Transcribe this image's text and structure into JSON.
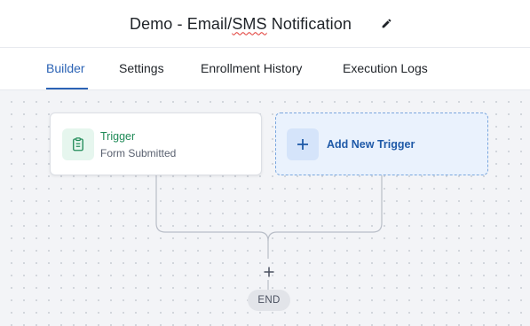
{
  "header": {
    "title_before": "Demo - Email/",
    "title_flagged": "SMS",
    "title_after": " Notification",
    "edit_icon": "pencil-icon"
  },
  "tabs": [
    {
      "label": "Builder",
      "active": true
    },
    {
      "label": "Settings",
      "active": false
    },
    {
      "label": "Enrollment History",
      "active": false
    },
    {
      "label": "Execution Logs",
      "active": false
    }
  ],
  "workflow": {
    "trigger": {
      "title": "Trigger",
      "subtitle": "Form Submitted",
      "icon": "clipboard-icon"
    },
    "add_trigger": {
      "label": "Add New Trigger",
      "icon": "plus-icon"
    },
    "add_step_icon": "plus-icon",
    "end_label": "END"
  },
  "colors": {
    "accent": "#2b63b5",
    "trigger_green": "#1f8a57",
    "add_trigger_blue": "#1f5aa8",
    "canvas_bg": "#f3f4f7"
  }
}
